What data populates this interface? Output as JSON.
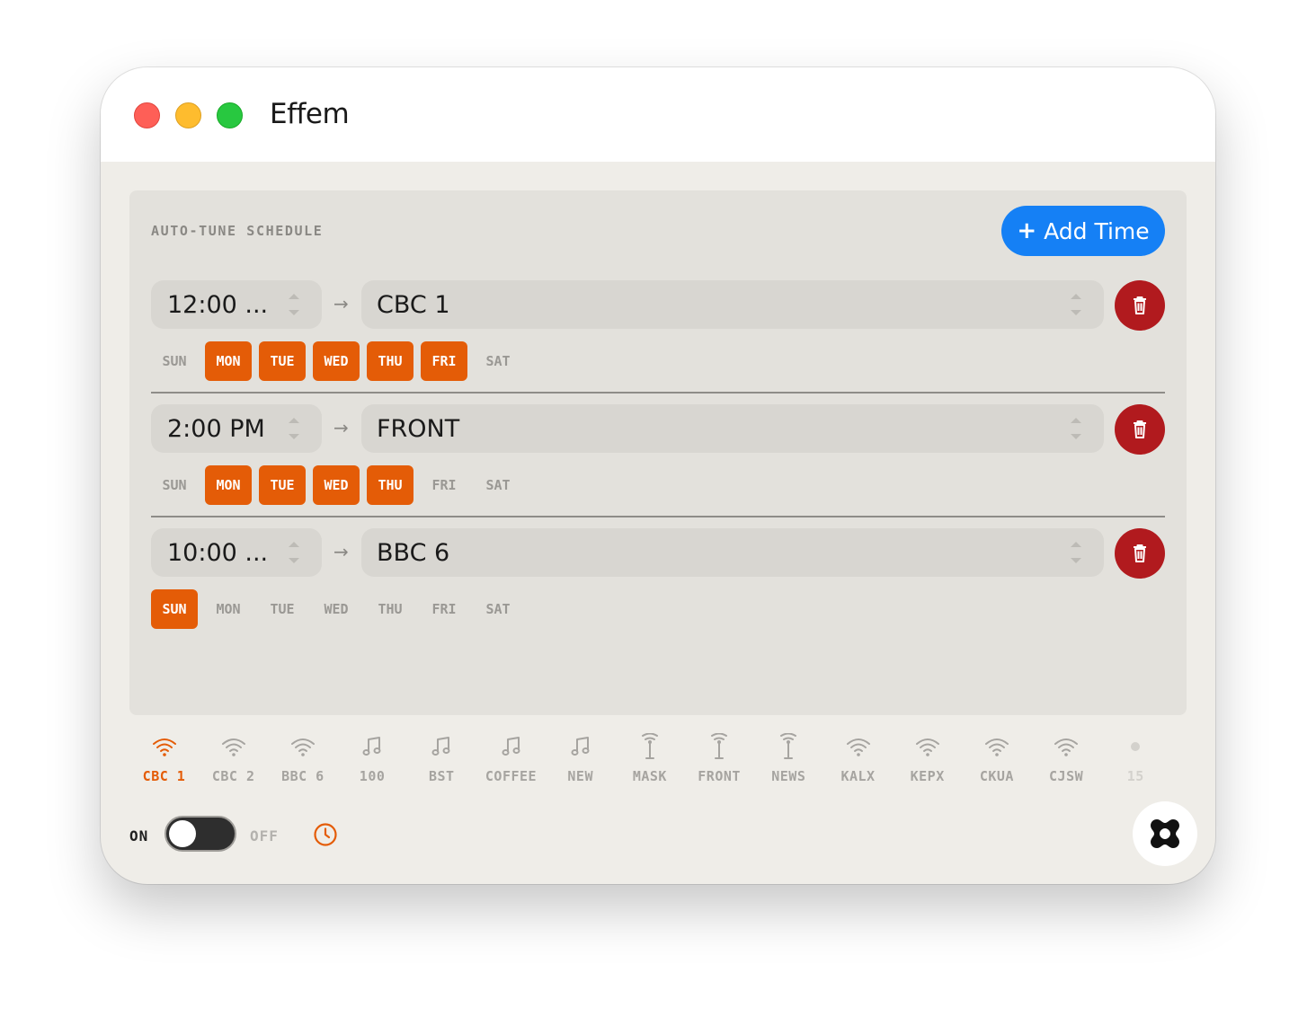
{
  "window": {
    "title": "Effem"
  },
  "schedule": {
    "section_label": "AUTO-TUNE SCHEDULE",
    "add_button": {
      "icon": "plus-icon",
      "label": "Add Time"
    },
    "days": [
      "SUN",
      "MON",
      "TUE",
      "WED",
      "THU",
      "FRI",
      "SAT"
    ],
    "entries": [
      {
        "time": "12:00 ...",
        "station": "CBC 1",
        "active_days": [
          false,
          true,
          true,
          true,
          true,
          true,
          false
        ]
      },
      {
        "time": "2:00 PM",
        "station": "FRONT",
        "active_days": [
          false,
          true,
          true,
          true,
          true,
          false,
          false
        ]
      },
      {
        "time": "10:00 ...",
        "station": "BBC 6",
        "active_days": [
          true,
          false,
          false,
          false,
          false,
          false,
          false
        ]
      }
    ],
    "arrow": "→",
    "delete_icon": "trash-icon"
  },
  "stations": [
    {
      "label": "CBC 1",
      "icon": "wifi-icon",
      "active": true
    },
    {
      "label": "CBC 2",
      "icon": "wifi-icon",
      "active": false
    },
    {
      "label": "BBC 6",
      "icon": "wifi-icon",
      "active": false
    },
    {
      "label": "100",
      "icon": "music-note-icon",
      "active": false
    },
    {
      "label": "BST",
      "icon": "music-note-icon",
      "active": false
    },
    {
      "label": "COFFEE",
      "icon": "music-note-icon",
      "active": false
    },
    {
      "label": "NEW",
      "icon": "music-note-icon",
      "active": false
    },
    {
      "label": "MASK",
      "icon": "antenna-icon",
      "active": false
    },
    {
      "label": "FRONT",
      "icon": "antenna-icon",
      "active": false
    },
    {
      "label": "NEWS",
      "icon": "antenna-icon",
      "active": false
    },
    {
      "label": "KALX",
      "icon": "wifi-icon",
      "active": false
    },
    {
      "label": "KEPX",
      "icon": "wifi-icon",
      "active": false
    },
    {
      "label": "CKUA",
      "icon": "wifi-icon",
      "active": false
    },
    {
      "label": "CJSW",
      "icon": "wifi-icon",
      "active": false
    },
    {
      "label": "15",
      "icon": "dot-icon",
      "active": false,
      "empty": true
    }
  ],
  "footer": {
    "on_label": "ON",
    "off_label": "OFF",
    "toggle_state": "on",
    "clock_icon": "clock-icon",
    "logo_icon": "effem-logo-icon"
  },
  "colors": {
    "accent_orange": "#e45c07",
    "add_button_blue": "#1580f5",
    "delete_red": "#b11a1e",
    "panel_bg": "#e3e1dc",
    "window_bg": "#efede8"
  }
}
